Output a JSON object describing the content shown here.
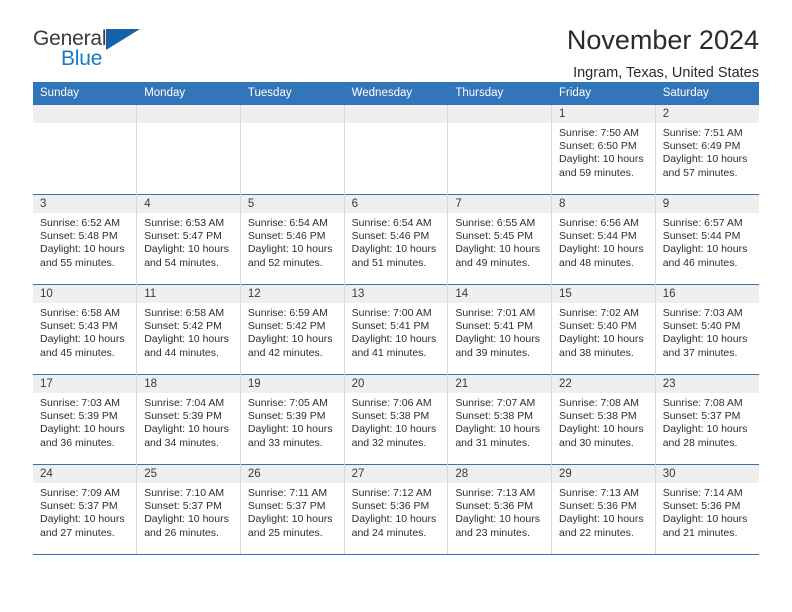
{
  "logo": {
    "word_one": "General",
    "word_two": "Blue",
    "triangle_icon": "blue-triangle-icon"
  },
  "header": {
    "title": "November 2024",
    "subtitle": "Ingram, Texas, United States"
  },
  "colors": {
    "header_blue": "#3275b8",
    "daynum_gray": "#efefef",
    "logo_blue": "#1a7bc4",
    "triangle_blue": "#1263a8"
  },
  "weekday_headers": [
    "Sunday",
    "Monday",
    "Tuesday",
    "Wednesday",
    "Thursday",
    "Friday",
    "Saturday"
  ],
  "labels": {
    "sunrise_prefix": "Sunrise:",
    "sunset_prefix": "Sunset:",
    "daylight_prefix": "Daylight:"
  },
  "weeks": [
    [
      {
        "day": "",
        "empty": true
      },
      {
        "day": "",
        "empty": true
      },
      {
        "day": "",
        "empty": true
      },
      {
        "day": "",
        "empty": true
      },
      {
        "day": "",
        "empty": true
      },
      {
        "day": "1",
        "sunrise": "Sunrise: 7:50 AM",
        "sunset": "Sunset: 6:50 PM",
        "daylight_line1": "Daylight: 10 hours",
        "daylight_line2": "and 59 minutes."
      },
      {
        "day": "2",
        "sunrise": "Sunrise: 7:51 AM",
        "sunset": "Sunset: 6:49 PM",
        "daylight_line1": "Daylight: 10 hours",
        "daylight_line2": "and 57 minutes."
      }
    ],
    [
      {
        "day": "3",
        "sunrise": "Sunrise: 6:52 AM",
        "sunset": "Sunset: 5:48 PM",
        "daylight_line1": "Daylight: 10 hours",
        "daylight_line2": "and 55 minutes."
      },
      {
        "day": "4",
        "sunrise": "Sunrise: 6:53 AM",
        "sunset": "Sunset: 5:47 PM",
        "daylight_line1": "Daylight: 10 hours",
        "daylight_line2": "and 54 minutes."
      },
      {
        "day": "5",
        "sunrise": "Sunrise: 6:54 AM",
        "sunset": "Sunset: 5:46 PM",
        "daylight_line1": "Daylight: 10 hours",
        "daylight_line2": "and 52 minutes."
      },
      {
        "day": "6",
        "sunrise": "Sunrise: 6:54 AM",
        "sunset": "Sunset: 5:46 PM",
        "daylight_line1": "Daylight: 10 hours",
        "daylight_line2": "and 51 minutes."
      },
      {
        "day": "7",
        "sunrise": "Sunrise: 6:55 AM",
        "sunset": "Sunset: 5:45 PM",
        "daylight_line1": "Daylight: 10 hours",
        "daylight_line2": "and 49 minutes."
      },
      {
        "day": "8",
        "sunrise": "Sunrise: 6:56 AM",
        "sunset": "Sunset: 5:44 PM",
        "daylight_line1": "Daylight: 10 hours",
        "daylight_line2": "and 48 minutes."
      },
      {
        "day": "9",
        "sunrise": "Sunrise: 6:57 AM",
        "sunset": "Sunset: 5:44 PM",
        "daylight_line1": "Daylight: 10 hours",
        "daylight_line2": "and 46 minutes."
      }
    ],
    [
      {
        "day": "10",
        "sunrise": "Sunrise: 6:58 AM",
        "sunset": "Sunset: 5:43 PM",
        "daylight_line1": "Daylight: 10 hours",
        "daylight_line2": "and 45 minutes."
      },
      {
        "day": "11",
        "sunrise": "Sunrise: 6:58 AM",
        "sunset": "Sunset: 5:42 PM",
        "daylight_line1": "Daylight: 10 hours",
        "daylight_line2": "and 44 minutes."
      },
      {
        "day": "12",
        "sunrise": "Sunrise: 6:59 AM",
        "sunset": "Sunset: 5:42 PM",
        "daylight_line1": "Daylight: 10 hours",
        "daylight_line2": "and 42 minutes."
      },
      {
        "day": "13",
        "sunrise": "Sunrise: 7:00 AM",
        "sunset": "Sunset: 5:41 PM",
        "daylight_line1": "Daylight: 10 hours",
        "daylight_line2": "and 41 minutes."
      },
      {
        "day": "14",
        "sunrise": "Sunrise: 7:01 AM",
        "sunset": "Sunset: 5:41 PM",
        "daylight_line1": "Daylight: 10 hours",
        "daylight_line2": "and 39 minutes."
      },
      {
        "day": "15",
        "sunrise": "Sunrise: 7:02 AM",
        "sunset": "Sunset: 5:40 PM",
        "daylight_line1": "Daylight: 10 hours",
        "daylight_line2": "and 38 minutes."
      },
      {
        "day": "16",
        "sunrise": "Sunrise: 7:03 AM",
        "sunset": "Sunset: 5:40 PM",
        "daylight_line1": "Daylight: 10 hours",
        "daylight_line2": "and 37 minutes."
      }
    ],
    [
      {
        "day": "17",
        "sunrise": "Sunrise: 7:03 AM",
        "sunset": "Sunset: 5:39 PM",
        "daylight_line1": "Daylight: 10 hours",
        "daylight_line2": "and 36 minutes."
      },
      {
        "day": "18",
        "sunrise": "Sunrise: 7:04 AM",
        "sunset": "Sunset: 5:39 PM",
        "daylight_line1": "Daylight: 10 hours",
        "daylight_line2": "and 34 minutes."
      },
      {
        "day": "19",
        "sunrise": "Sunrise: 7:05 AM",
        "sunset": "Sunset: 5:39 PM",
        "daylight_line1": "Daylight: 10 hours",
        "daylight_line2": "and 33 minutes."
      },
      {
        "day": "20",
        "sunrise": "Sunrise: 7:06 AM",
        "sunset": "Sunset: 5:38 PM",
        "daylight_line1": "Daylight: 10 hours",
        "daylight_line2": "and 32 minutes."
      },
      {
        "day": "21",
        "sunrise": "Sunrise: 7:07 AM",
        "sunset": "Sunset: 5:38 PM",
        "daylight_line1": "Daylight: 10 hours",
        "daylight_line2": "and 31 minutes."
      },
      {
        "day": "22",
        "sunrise": "Sunrise: 7:08 AM",
        "sunset": "Sunset: 5:38 PM",
        "daylight_line1": "Daylight: 10 hours",
        "daylight_line2": "and 30 minutes."
      },
      {
        "day": "23",
        "sunrise": "Sunrise: 7:08 AM",
        "sunset": "Sunset: 5:37 PM",
        "daylight_line1": "Daylight: 10 hours",
        "daylight_line2": "and 28 minutes."
      }
    ],
    [
      {
        "day": "24",
        "sunrise": "Sunrise: 7:09 AM",
        "sunset": "Sunset: 5:37 PM",
        "daylight_line1": "Daylight: 10 hours",
        "daylight_line2": "and 27 minutes."
      },
      {
        "day": "25",
        "sunrise": "Sunrise: 7:10 AM",
        "sunset": "Sunset: 5:37 PM",
        "daylight_line1": "Daylight: 10 hours",
        "daylight_line2": "and 26 minutes."
      },
      {
        "day": "26",
        "sunrise": "Sunrise: 7:11 AM",
        "sunset": "Sunset: 5:37 PM",
        "daylight_line1": "Daylight: 10 hours",
        "daylight_line2": "and 25 minutes."
      },
      {
        "day": "27",
        "sunrise": "Sunrise: 7:12 AM",
        "sunset": "Sunset: 5:36 PM",
        "daylight_line1": "Daylight: 10 hours",
        "daylight_line2": "and 24 minutes."
      },
      {
        "day": "28",
        "sunrise": "Sunrise: 7:13 AM",
        "sunset": "Sunset: 5:36 PM",
        "daylight_line1": "Daylight: 10 hours",
        "daylight_line2": "and 23 minutes."
      },
      {
        "day": "29",
        "sunrise": "Sunrise: 7:13 AM",
        "sunset": "Sunset: 5:36 PM",
        "daylight_line1": "Daylight: 10 hours",
        "daylight_line2": "and 22 minutes."
      },
      {
        "day": "30",
        "sunrise": "Sunrise: 7:14 AM",
        "sunset": "Sunset: 5:36 PM",
        "daylight_line1": "Daylight: 10 hours",
        "daylight_line2": "and 21 minutes."
      }
    ]
  ]
}
